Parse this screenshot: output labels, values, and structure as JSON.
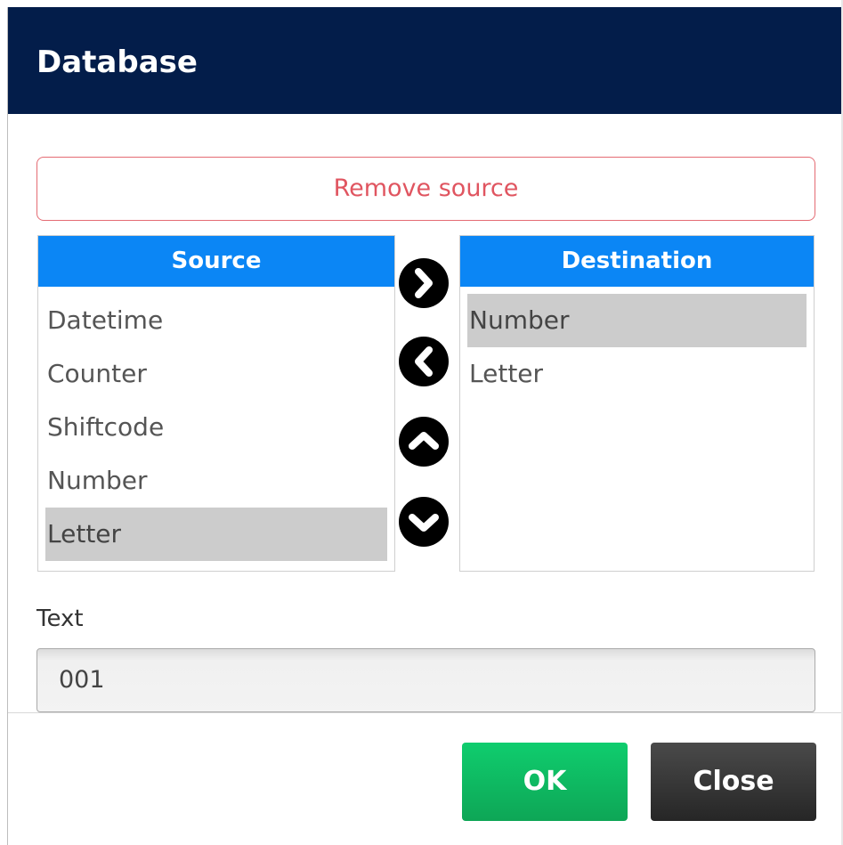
{
  "dialog": {
    "title": "Database",
    "remove_source_label": "Remove source",
    "source_list": {
      "header": "Source",
      "items": [
        "Datetime",
        "Counter",
        "Shiftcode",
        "Number",
        "Letter"
      ],
      "selected": "Letter"
    },
    "destination_list": {
      "header": "Destination",
      "items": [
        "Number",
        "Letter"
      ],
      "selected": "Number"
    },
    "arrows": [
      "arrow-right-icon",
      "arrow-left-icon",
      "arrow-up-icon",
      "arrow-down-icon"
    ],
    "text_field": {
      "label": "Text",
      "value": "001"
    },
    "buttons": {
      "ok": "OK",
      "close": "Close"
    },
    "colors": {
      "titlebar": "#031d4a",
      "list_header": "#0b86f5",
      "remove_border": "#e46b73",
      "ok": "#0fcd6e",
      "close": "#2f2f2f",
      "selected_row": "#cccccc"
    }
  }
}
